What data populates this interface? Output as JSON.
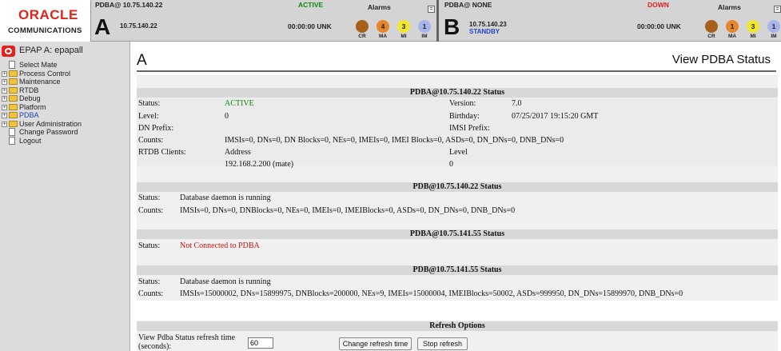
{
  "header": {
    "logo_oracle": "ORACLE",
    "logo_comm": "COMMUNICATIONS",
    "alarms_heading": "Alarms",
    "alarm_labels": [
      "CR",
      "MA",
      "MI",
      "IM"
    ],
    "panel_a": {
      "label": "PDBA@ 10.75.140.22",
      "letter": "A",
      "ip": "10.75.140.22",
      "role": " ",
      "status": "ACTIVE",
      "time": "00:00:00 UNK",
      "alarm_counts": [
        "",
        "4",
        "3",
        "1"
      ]
    },
    "panel_b": {
      "label": "PDBA@ NONE",
      "letter": "B",
      "ip": "10.75.140.23",
      "role": "STANDBY",
      "status": "DOWN",
      "time": "00:00:00 UNK",
      "alarm_counts": [
        "",
        "1",
        "3",
        "1"
      ]
    },
    "colors": {
      "active": "#0a8a0a",
      "down": "#e02020",
      "standby": "#2244cc",
      "cr": "#a6601a",
      "ma": "#e8842a",
      "mi": "#f0e830",
      "im": "#a8b4ec"
    }
  },
  "sidebar": {
    "title": "EPAP A: epapall",
    "items": [
      {
        "label": "Select Mate",
        "type": "doc"
      },
      {
        "label": "Process Control",
        "type": "folder"
      },
      {
        "label": "Maintenance",
        "type": "folder"
      },
      {
        "label": "RTDB",
        "type": "folder"
      },
      {
        "label": "Debug",
        "type": "folder"
      },
      {
        "label": "Platform",
        "type": "folder"
      },
      {
        "label": "PDBA",
        "type": "folder"
      },
      {
        "label": "User Administration",
        "type": "folder"
      },
      {
        "label": "Change Password",
        "type": "doc"
      },
      {
        "label": "Logout",
        "type": "doc"
      }
    ]
  },
  "main": {
    "title": "A",
    "heading": "View PDBA Status",
    "pdba_local": {
      "heading": "PDBA@10.75.140.22 Status",
      "status_label": "Status:",
      "status_value": "ACTIVE",
      "version_label": "Version:",
      "version_value": "7.0",
      "level_label": "Level:",
      "level_value": "0",
      "birthday_label": "Birthday:",
      "birthday_value": "07/25/2017 19:15:20 GMT",
      "dn_prefix_label": "DN Prefix:",
      "imsi_prefix_label": "IMSI Prefix:",
      "counts_label": "Counts:",
      "counts_value": "IMSIs=0, DNs=0, DN Blocks=0, NEs=0, IMEIs=0, IMEI Blocks=0, ASDs=0, DN_DNs=0, DNB_DNs=0",
      "rtdb_clients_label": "RTDB Clients:",
      "address_header": "Address",
      "level_header": "Level",
      "client_address": "192.168.2.200 (mate)",
      "client_level": "0"
    },
    "pdb_local": {
      "heading": "PDB@10.75.140.22 Status",
      "status_label": "Status:",
      "status_value": "Database daemon is running",
      "counts_label": "Counts:",
      "counts_value": "IMSIs=0, DNs=0, DNBlocks=0, NEs=0, IMEIs=0, IMEIBlocks=0, ASDs=0, DN_DNs=0, DNB_DNs=0"
    },
    "pdba_remote": {
      "heading": "PDBA@10.75.141.55 Status",
      "status_label": "Status:",
      "status_value": "Not Connected to PDBA"
    },
    "pdb_remote": {
      "heading": "PDB@10.75.141.55 Status",
      "status_label": "Status:",
      "status_value": "Database daemon is running",
      "counts_label": "Counts:",
      "counts_value": "IMSIs=15000002, DNs=15899975, DNBlocks=200000, NEs=9, IMEIs=15000004, IMEIBlocks=50002, ASDs=999950, DN_DNs=15899970, DNB_DNs=0"
    },
    "refresh": {
      "heading": "Refresh Options",
      "label_line1": "View Pdba Status refresh time",
      "label_line2": "(seconds):",
      "value": "60",
      "change_button": "Change refresh time",
      "stop_button": "Stop refresh"
    }
  }
}
